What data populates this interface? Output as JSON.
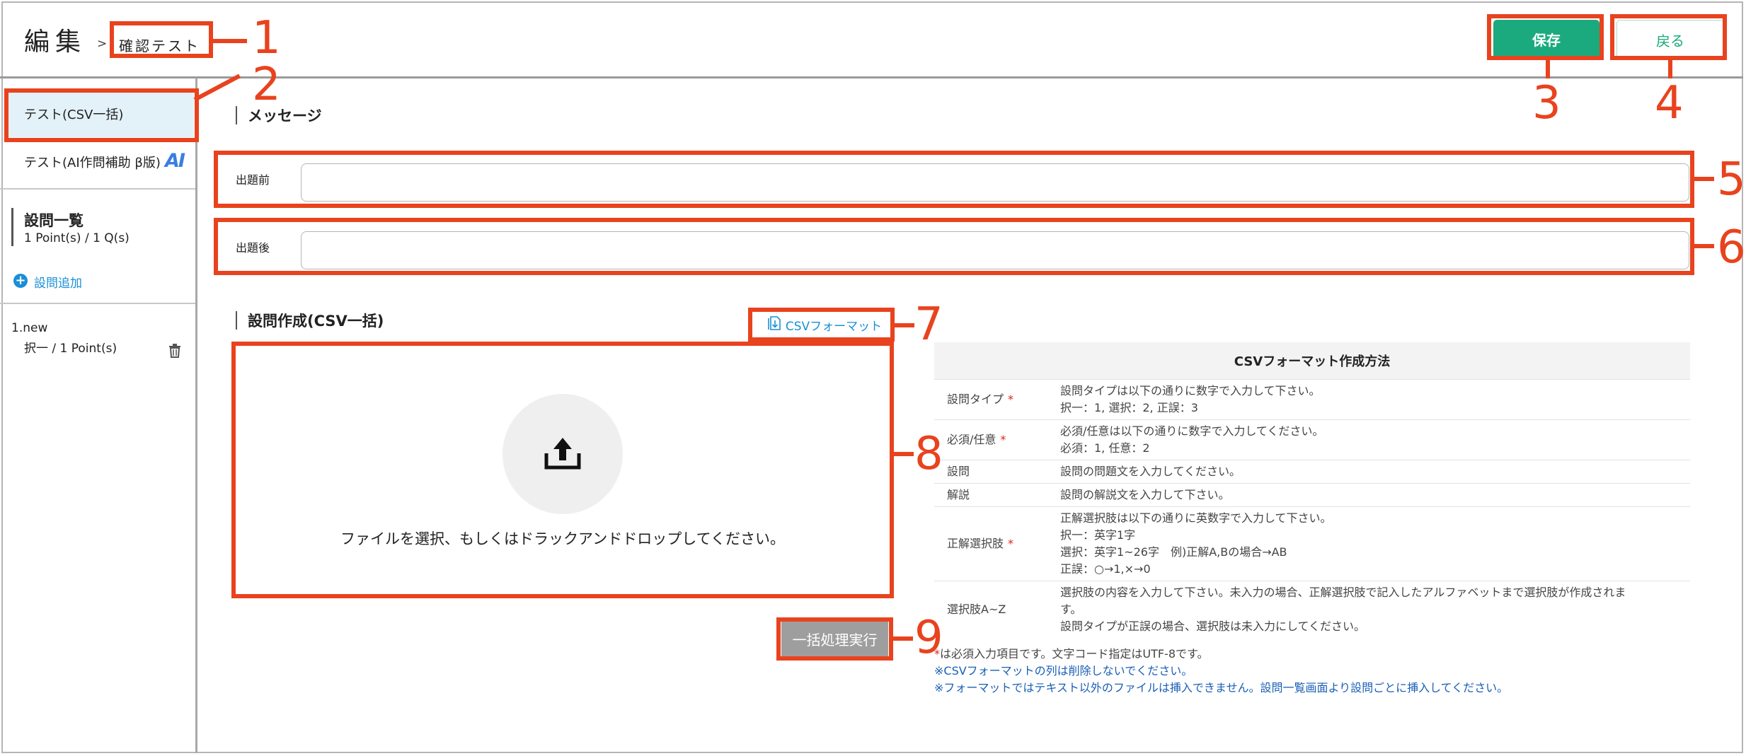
{
  "header": {
    "title": "編集",
    "crumb_sep": ">",
    "breadcrumb": "確認テスト",
    "save_label": "保存",
    "back_label": "戻る"
  },
  "sidebar": {
    "items": [
      {
        "label": "テスト(CSV一括)"
      },
      {
        "label": "テスト(AI作問補助 β版)",
        "logo": "AI"
      }
    ],
    "question_list": {
      "title": "設問一覧",
      "summary": "1 Point(s) / 1 Q(s)"
    },
    "add_question": {
      "label": "設問追加"
    },
    "questions": [
      {
        "name": "1.new",
        "meta": "択一 / 1 Point(s)"
      }
    ]
  },
  "message": {
    "title": "メッセージ",
    "before_label": "出題前",
    "before_value": "",
    "after_label": "出題後",
    "after_value": ""
  },
  "csv": {
    "title": "設問作成(CSV一括)",
    "format_link": "CSVフォーマット",
    "drop_text": "ファイルを選択、もしくはドラックアンドドロップしてください。",
    "bulk_button": "一括処理実行"
  },
  "format_table": {
    "title": "CSVフォーマット作成方法",
    "rows": [
      {
        "key": "設問タイプ",
        "required": true,
        "lines": [
          "設問タイプは以下の通りに数字で入力して下さい。",
          "択一：1, 選択：2, 正誤：3"
        ]
      },
      {
        "key": "必須/任意",
        "required": true,
        "lines": [
          "必須/任意は以下の通りに数字で入力してください。",
          "必須：1, 任意：2"
        ]
      },
      {
        "key": "設問",
        "required": false,
        "lines": [
          "設問の問題文を入力してください。"
        ]
      },
      {
        "key": "解説",
        "required": false,
        "lines": [
          "設問の解説文を入力して下さい。"
        ]
      },
      {
        "key": "正解選択肢",
        "required": true,
        "lines": [
          "正解選択肢は以下の通りに英数字で入力して下さい。",
          "択一：英字1字",
          "選択：英字1~26字　例)正解A,Bの場合→AB",
          "正誤：○→1,×→0"
        ]
      },
      {
        "key": "選択肢A~Z",
        "required": false,
        "lines": [
          "選択肢の内容を入力して下さい。未入力の場合、正解選択肢で記入したアルファベットまで選択肢が作成されま",
          "す。",
          "設問タイプが正誤の場合、選択肢は未入力にしてください。"
        ]
      }
    ],
    "required_mark": "*"
  },
  "notes": {
    "required_note": "は必須入力項目です。文字コード指定はUTF-8です。",
    "note1": "※CSVフォーマットの列は削除しないでください。",
    "note2": "※フォーマットではテキスト以外のファイルは挿入できません。設問一覧画面より設問ごとに挿入してください。"
  },
  "annotations": [
    "1",
    "2",
    "3",
    "4",
    "5",
    "6",
    "7",
    "8",
    "9"
  ],
  "colors": {
    "accent": "#1baa7d",
    "annotation": "#e8431e",
    "link": "#1a8fd6",
    "required": "#e02020"
  },
  "icons": [
    "upload-icon",
    "csv-download-icon",
    "trash-icon",
    "plus-icon",
    "ai-logo-icon"
  ]
}
